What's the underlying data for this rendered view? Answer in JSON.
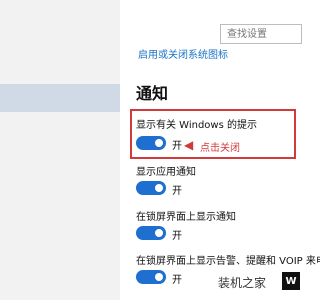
{
  "colors": {
    "accent": "#1e6fd0",
    "annotation": "#d03a3a",
    "sidebar_bg": "#f2f2f2",
    "sidebar_selected": "#d0d9e6",
    "link": "#1a73c8"
  },
  "search": {
    "placeholder": "查找设置"
  },
  "link_top": "启用或关闭系统图标",
  "section": {
    "title": "通知"
  },
  "settings": [
    {
      "label": "显示有关 Windows 的提示",
      "state": "开",
      "on": true
    },
    {
      "label": "显示应用通知",
      "state": "开",
      "on": true
    },
    {
      "label": "在锁屏界面上显示通知",
      "state": "开",
      "on": true
    },
    {
      "label": "在锁屏界面上显示告警、提醒和 VOIP 来电",
      "state": "开",
      "on": true
    }
  ],
  "annotation": {
    "text": "点击关闭",
    "icon": "left-arrow-icon"
  },
  "watermark": {
    "text": "装机之家",
    "badge": "W"
  }
}
